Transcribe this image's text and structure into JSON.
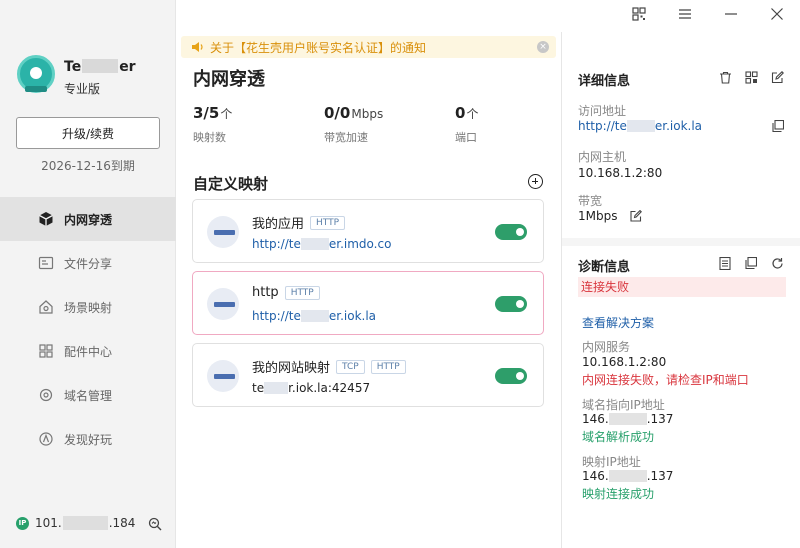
{
  "app": {
    "name_prefix": "Te",
    "name_suffix": "er",
    "edition": "专业版",
    "upgrade_label": "升级/续费",
    "expire": "2026-12-16到期"
  },
  "sidebar": {
    "items": [
      {
        "label": "内网穿透",
        "icon": "cube-icon",
        "active": true
      },
      {
        "label": "文件分享",
        "icon": "file-share-icon"
      },
      {
        "label": "场景映射",
        "icon": "scene-home-icon"
      },
      {
        "label": "配件中心",
        "icon": "accessory-grid-icon"
      },
      {
        "label": "域名管理",
        "icon": "domain-gear-icon"
      },
      {
        "label": "发现好玩",
        "icon": "discover-icon"
      }
    ],
    "footer": {
      "ip_badge": "IP",
      "ip_prefix": "101.",
      "ip_suffix": ".184"
    }
  },
  "notice": {
    "text": "关于【花生壳用户账号实名认证】的通知",
    "close": "×"
  },
  "main": {
    "title": "内网穿透",
    "stats": [
      {
        "value": "3/5",
        "unit": "个",
        "label": "映射数"
      },
      {
        "value": "0/0",
        "unit": "Mbps",
        "label": "带宽加速"
      },
      {
        "value": "0",
        "unit": "个",
        "label": "端口"
      }
    ],
    "section_title": "自定义映射",
    "mappings": [
      {
        "name": "我的应用",
        "tags": [
          "HTTP"
        ],
        "url_prefix": "http://te",
        "url_suffix": "er.imdo.co",
        "link": true,
        "enabled": true
      },
      {
        "name": "http",
        "tags": [
          "HTTP"
        ],
        "url_prefix": "http://te",
        "url_suffix": "er.iok.la",
        "link": true,
        "enabled": true
      },
      {
        "name": "我的网站映射",
        "tags": [
          "TCP",
          "HTTP"
        ],
        "url_prefix": "te",
        "url_suffix": "r.iok.la:42457",
        "link": false,
        "enabled": true
      }
    ]
  },
  "detail": {
    "title": "详细信息",
    "access_label": "访问地址",
    "access_prefix": "http://te",
    "access_suffix": "er.iok.la",
    "host_label": "内网主机",
    "host_value": "10.168.1.2:80",
    "bandwidth_label": "带宽",
    "bandwidth_value": "1Mbps"
  },
  "diagnosis": {
    "title": "诊断信息",
    "status": "连接失败",
    "solution_link": "查看解决方案",
    "service_label": "内网服务",
    "service_value": "10.168.1.2:80",
    "service_error": "内网连接失败，请检查IP和端口",
    "domain_ip_label": "域名指向IP地址",
    "domain_ip_prefix": "146.",
    "domain_ip_suffix": ".137",
    "domain_ok": "域名解析成功",
    "map_ip_label": "映射IP地址",
    "map_ip_prefix": "146.",
    "map_ip_suffix": ".137",
    "map_ok": "映射连接成功"
  }
}
